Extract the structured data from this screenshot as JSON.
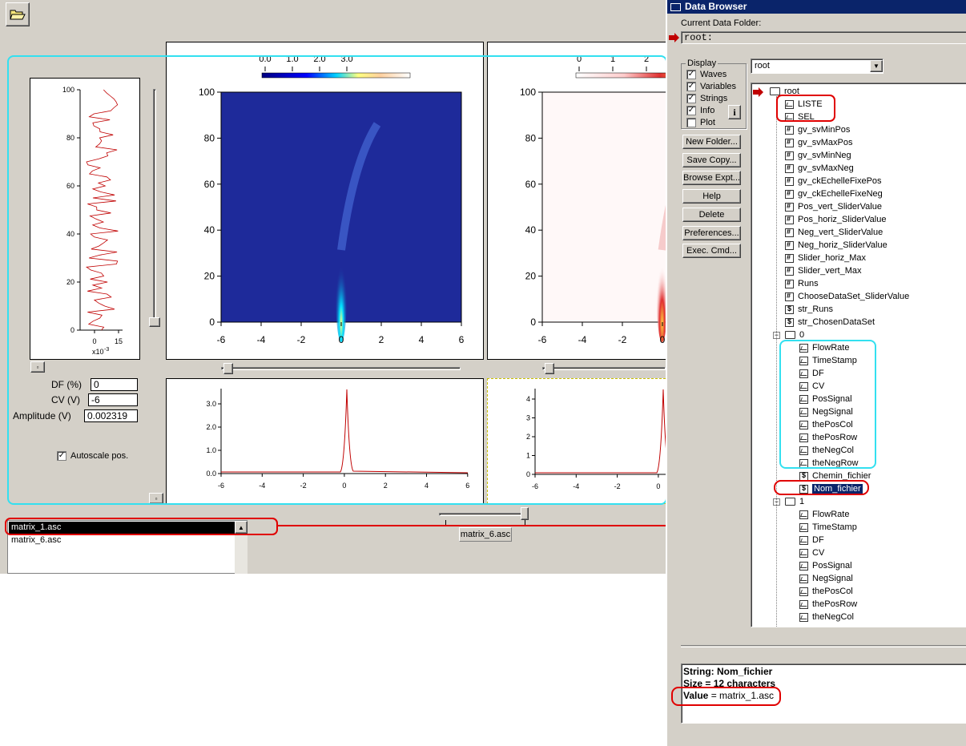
{
  "main": {
    "list_items": [
      "matrix_1.asc",
      "matrix_6.asc"
    ],
    "slider_value_label": "matrix_6.asc",
    "fields": {
      "df_label": "DF (%)",
      "df_value": "0",
      "cv_label": "CV (V)",
      "cv_value": "-6",
      "amp_label": "Amplitude (V)",
      "amp_value": "0.002319"
    },
    "autoscale_label": "Autoscale pos.",
    "side_plot": {
      "y_ticks": [
        "100",
        "80",
        "60",
        "40",
        "20",
        "0"
      ],
      "x_ticks": [
        "0",
        "15"
      ],
      "x_mult": "x10",
      "x_mult_exp": "-3"
    },
    "main_plot": {
      "y_ticks": [
        "100",
        "80",
        "60",
        "40",
        "20",
        "0"
      ],
      "x_ticks": [
        "-6",
        "-4",
        "-2",
        "0",
        "2",
        "4",
        "6"
      ]
    },
    "colorbar_left": [
      "0.0",
      "1.0",
      "2.0",
      "3.0"
    ],
    "colorbar_right": [
      "0",
      "1",
      "2"
    ],
    "right_plot": {
      "y_ticks": [
        "100",
        "80",
        "60",
        "40",
        "20",
        "0"
      ],
      "x_ticks": [
        "-6",
        "-4",
        "-2",
        "0"
      ]
    },
    "bottom_left": {
      "y_ticks": [
        "3.0",
        "2.0",
        "1.0",
        "0.0"
      ],
      "x_ticks": [
        "-6",
        "-4",
        "-2",
        "0",
        "2",
        "4",
        "6"
      ]
    },
    "bottom_right": {
      "y_ticks": [
        "4",
        "3",
        "2",
        "1",
        "0"
      ],
      "x_ticks": [
        "-6",
        "-4",
        "-2",
        "0"
      ]
    }
  },
  "browser": {
    "title": "Data Browser",
    "current_folder_label": "Current Data Folder:",
    "current_folder": "root:",
    "folder_select": "root",
    "display_label": "Display",
    "display_options": [
      {
        "label": "Waves",
        "checked": true
      },
      {
        "label": "Variables",
        "checked": true
      },
      {
        "label": "Strings",
        "checked": true
      },
      {
        "label": "Info",
        "checked": true
      },
      {
        "label": "Plot",
        "checked": false
      }
    ],
    "info_icon": "i",
    "buttons": [
      "New Folder...",
      "Save Copy...",
      "Browse Expt...",
      "Help",
      "Delete",
      "Preferences...",
      "Exec. Cmd..."
    ],
    "tree": [
      {
        "label": "root",
        "icon": "folder",
        "level": 0
      },
      {
        "label": "LISTE",
        "icon": "wave",
        "level": 1
      },
      {
        "label": "SEL",
        "icon": "wave",
        "level": 1
      },
      {
        "label": "gv_svMinPos",
        "icon": "var",
        "level": 1
      },
      {
        "label": "gv_svMaxPos",
        "icon": "var",
        "level": 1
      },
      {
        "label": "gv_svMinNeg",
        "icon": "var",
        "level": 1
      },
      {
        "label": "gv_svMaxNeg",
        "icon": "var",
        "level": 1
      },
      {
        "label": "gv_ckEchelleFixePos",
        "icon": "var",
        "level": 1
      },
      {
        "label": "gv_ckEchelleFixeNeg",
        "icon": "var",
        "level": 1
      },
      {
        "label": "Pos_vert_SliderValue",
        "icon": "var",
        "level": 1
      },
      {
        "label": "Pos_horiz_SliderValue",
        "icon": "var",
        "level": 1
      },
      {
        "label": "Neg_vert_SliderValue",
        "icon": "var",
        "level": 1
      },
      {
        "label": "Neg_horiz_SliderValue",
        "icon": "var",
        "level": 1
      },
      {
        "label": "Slider_horiz_Max",
        "icon": "var",
        "level": 1
      },
      {
        "label": "Slider_vert_Max",
        "icon": "var",
        "level": 1
      },
      {
        "label": "Runs",
        "icon": "var",
        "level": 1
      },
      {
        "label": "ChooseDataSet_SliderValue",
        "icon": "var",
        "level": 1
      },
      {
        "label": "str_Runs",
        "icon": "str",
        "level": 1
      },
      {
        "label": "str_ChosenDataSet",
        "icon": "str",
        "level": 1
      },
      {
        "label": "0",
        "icon": "folder",
        "level": 1
      },
      {
        "label": "FlowRate",
        "icon": "wave",
        "level": 2
      },
      {
        "label": "TimeStamp",
        "icon": "wave",
        "level": 2
      },
      {
        "label": "DF",
        "icon": "wave",
        "level": 2
      },
      {
        "label": "CV",
        "icon": "wave",
        "level": 2
      },
      {
        "label": "PosSignal",
        "icon": "wave",
        "level": 2
      },
      {
        "label": "NegSignal",
        "icon": "wave",
        "level": 2
      },
      {
        "label": "thePosCol",
        "icon": "wave",
        "level": 2
      },
      {
        "label": "thePosRow",
        "icon": "wave",
        "level": 2
      },
      {
        "label": "theNegCol",
        "icon": "wave",
        "level": 2
      },
      {
        "label": "theNegRow",
        "icon": "wave",
        "level": 2
      },
      {
        "label": "Chemin_fichier",
        "icon": "str",
        "level": 2
      },
      {
        "label": "Nom_fichier",
        "icon": "str",
        "level": 2,
        "selected": true
      },
      {
        "label": "1",
        "icon": "folder",
        "level": 1
      },
      {
        "label": "FlowRate",
        "icon": "wave",
        "level": 2
      },
      {
        "label": "TimeStamp",
        "icon": "wave",
        "level": 2
      },
      {
        "label": "DF",
        "icon": "wave",
        "level": 2
      },
      {
        "label": "CV",
        "icon": "wave",
        "level": 2
      },
      {
        "label": "PosSignal",
        "icon": "wave",
        "level": 2
      },
      {
        "label": "NegSignal",
        "icon": "wave",
        "level": 2
      },
      {
        "label": "thePosCol",
        "icon": "wave",
        "level": 2
      },
      {
        "label": "thePosRow",
        "icon": "wave",
        "level": 2
      },
      {
        "label": "theNegCol",
        "icon": "wave",
        "level": 2
      }
    ],
    "info": {
      "line1_prefix": "String: ",
      "line1_name": "Nom_fichier",
      "line2": "Size = 12 characters",
      "line3_prefix": "Value",
      "line3_value": " = matrix_1.asc"
    }
  },
  "colors": {
    "highlight_cyan": "#33e0f0",
    "highlight_red": "#e00000",
    "selection": "#0a246a",
    "title_bar": "#0a246a"
  }
}
